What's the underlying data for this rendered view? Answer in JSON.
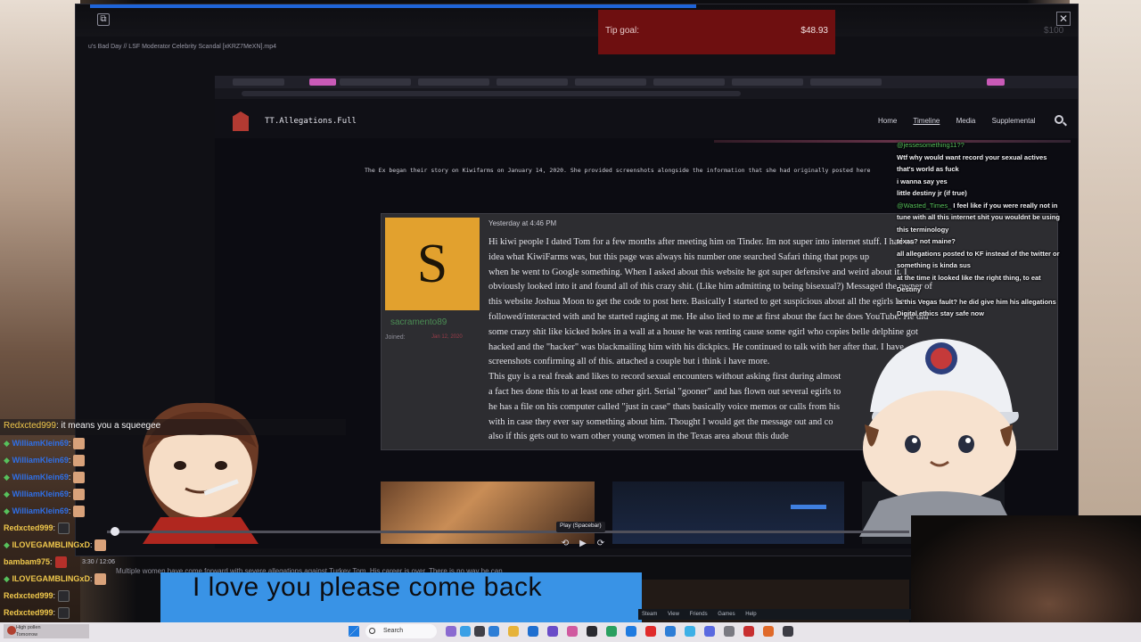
{
  "player": {
    "file_title": "u's Bad Day // LSF Moderator Celebrity Scandal [xKRZ7MeXN].mp4",
    "close_glyph": "✕",
    "icon_glyph": "⧉"
  },
  "tip_goal": {
    "label": "Tip goal:",
    "current": "$48.93",
    "target": "$100"
  },
  "site": {
    "title": "TT.Allegations.Full",
    "nav": [
      "Home",
      "Timeline",
      "Media",
      "Supplemental"
    ],
    "intro": "The Ex began their story on Kiwifarms on January 14, 2020. She provided screenshots alongside the information that she had originally posted here"
  },
  "post": {
    "time": "Yesterday at 4:46 PM",
    "avatar_letter": "S",
    "username": "sacramento89",
    "joined_label": "Joined:",
    "joined_value": "Jan 12, 2020",
    "lines": [
      "Hi kiwi people I dated Tom for a few months after meeting him on Tinder. Im not super into internet stuff. I had no",
      "idea what KiwiFarms was, but this page was always his number one searched Safari thing that pops up",
      "when he went to Google something. When I asked about this website he got super defensive and weird about it. I",
      "obviously looked into it and found all of this crazy shit. (Like him admitting to being bisexual?) Messaged the owner of",
      "this website Joshua Moon to get the code to post here. Basically I started to get suspicious about all the egirls he",
      "followed/interacted with and he started raging at me. He also lied to me at first about the fact he does YouTube. He did",
      "some crazy shit like kicked holes in a wall at a house he was renting cause some egirl who copies belle delphine got",
      "hacked and the \"hacker\" was blackmailing him with his dickpics. He continued to talk with her after that. I have",
      "screenshots confirming all of this. attached a couple but i think i have more.",
      "This guy is a real freak and likes to record sexual encounters without asking first during almost",
      "a fact hes done this to at least one other girl. Serial \"gooner\" and has flown out several egirls to",
      "he has a file on his computer called \"just in case\" thats basically voice memos or calls from his",
      "with in case they ever say something about him. Thought I would get the message out and co",
      "also if this gets out to warn other young women in the Texas area about this dude"
    ]
  },
  "overlay_chat": [
    {
      "user": "@jessesomething11??",
      "text": ""
    },
    {
      "user": "",
      "text": "Wtf why would want record your sexual actives that's world as fuck"
    },
    {
      "user": "",
      "text": "i wanna say yes"
    },
    {
      "user": "",
      "text": "little destiny jr (if true)"
    },
    {
      "user": "@Wasted_Times_",
      "text": "I feel like if you were really not in tune with all this internet shit you wouldnt be using this terminology"
    },
    {
      "user": "",
      "text": "texas? not maine?"
    },
    {
      "user": "",
      "text": "all allegations posted to KF instead of the twitter or something is kinda sus"
    },
    {
      "user": "",
      "text": "at the time it looked like the right thing, to eat Destiny"
    },
    {
      "user": "",
      "text": "is this Vegas fault? he did give him his allegations"
    },
    {
      "user": "",
      "text": "Digital ethics stay safe now"
    }
  ],
  "controls": {
    "time": "3:30 / 12:06",
    "tooltip": "Play (Spacebar)",
    "rewind": "⟲",
    "play": "▶",
    "forward": "⟳"
  },
  "subtitle": "Multiple women have come forward with severe allegations against Turkey Tom. His career is over. There is no way he can",
  "banner": {
    "text": "I love you please come back"
  },
  "chat": {
    "top": {
      "user": "Redxcted999",
      "text": ": it means you a squeegee"
    },
    "rows": [
      {
        "user": "WilliamKlein69",
        "sep": ":",
        "color": "blue",
        "badge": true
      },
      {
        "user": "WilliamKlein69",
        "sep": ":",
        "color": "blue",
        "badge": true
      },
      {
        "user": "WilliamKlein69",
        "sep": ":",
        "color": "blue",
        "badge": true
      },
      {
        "user": "WilliamKlein69",
        "sep": ":",
        "color": "blue",
        "badge": true
      },
      {
        "user": "WilliamKlein69",
        "sep": ":",
        "color": "blue",
        "badge": true
      },
      {
        "user": "Redxcted999",
        "sep": ":",
        "color": "gold",
        "badge": false
      },
      {
        "user": "ILOVEGAMBLINGxD",
        "sep": ":",
        "color": "gold",
        "badge": true
      },
      {
        "user": "bambam975",
        "sep": ":",
        "color": "gold",
        "badge": false
      },
      {
        "user": "ILOVEGAMBLINGxD",
        "sep": ":",
        "color": "gold",
        "badge": true
      },
      {
        "user": "Redxcted999",
        "sep": ":",
        "color": "gold",
        "badge": false
      },
      {
        "user": "Redxcted999",
        "sep": ":",
        "color": "gold",
        "badge": false
      }
    ]
  },
  "steam_bar": [
    "Steam",
    "View",
    "Friends",
    "Games",
    "Help"
  ],
  "taskbar": {
    "weather_line1": "High pollen",
    "weather_line2": "Tomorrow",
    "search_placeholder": "Search"
  },
  "colors": {
    "chat_blue": "#2f6fe6",
    "chat_gold": "#f0c84c",
    "banner_blue": "#3993e6",
    "tip_red": "#6e0f10",
    "avatar_orange": "#e2a12e"
  }
}
